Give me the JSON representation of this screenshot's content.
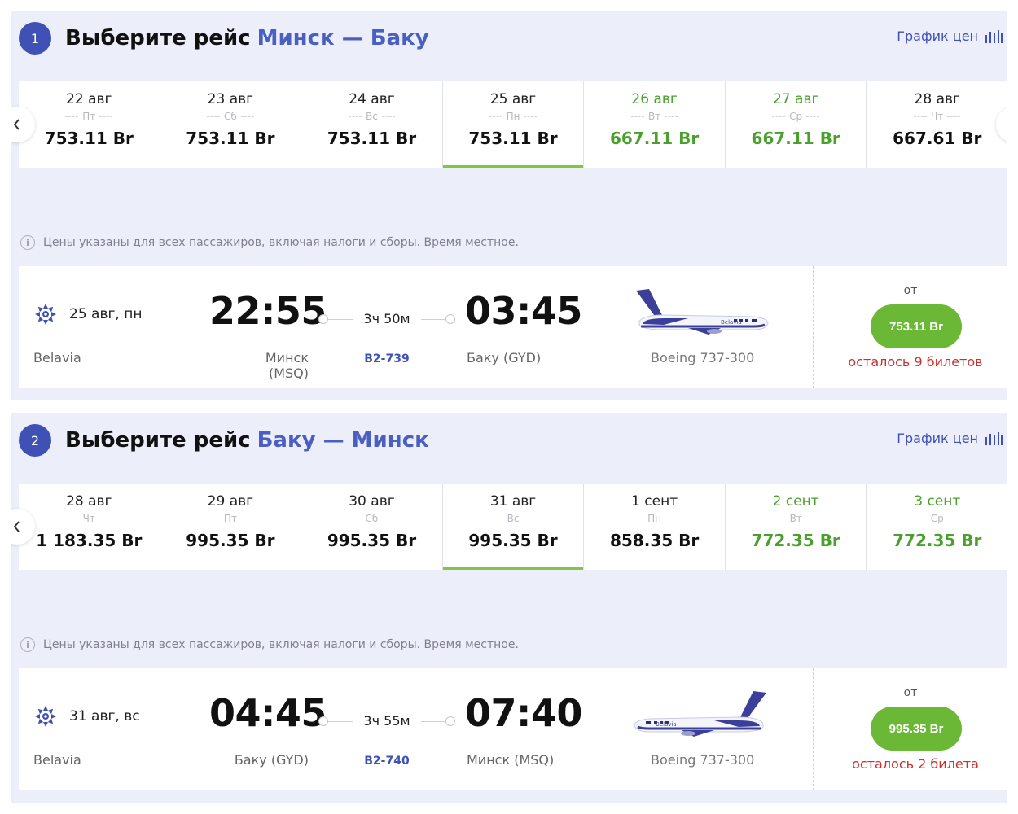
{
  "outbound": {
    "step": "1",
    "title": "Выберите рейс",
    "route": "Минск — Баку",
    "chart_link": "График цен",
    "dates": [
      {
        "date": "22 авг",
        "weekday": "Пт",
        "price": "753.11 Br",
        "state": "normal"
      },
      {
        "date": "23 авг",
        "weekday": "Сб",
        "price": "753.11 Br",
        "state": "normal"
      },
      {
        "date": "24 авг",
        "weekday": "Вс",
        "price": "753.11 Br",
        "state": "normal"
      },
      {
        "date": "25 авг",
        "weekday": "Пн",
        "price": "753.11 Br",
        "state": "active"
      },
      {
        "date": "26 авг",
        "weekday": "Вт",
        "price": "667.11 Br",
        "state": "green"
      },
      {
        "date": "27 авг",
        "weekday": "Ср",
        "price": "667.11 Br",
        "state": "green"
      },
      {
        "date": "28 авг",
        "weekday": "Чт",
        "price": "667.61 Br",
        "state": "normal"
      }
    ],
    "info": "Цены указаны для всех пассажиров, включая налоги и сборы. Время местное.",
    "flight": {
      "date": "25 авг, пн",
      "airline": "Belavia",
      "dep_time": "22:55",
      "dep_airport": "Минск (MSQ)",
      "duration": "3ч 50м",
      "flight_no": "B2-739",
      "arr_time": "03:45",
      "arr_airport": "Баку (GYD)",
      "aircraft": "Boeing 737-300",
      "plane_logo_text": "Belavia",
      "from_label": "от",
      "price": "753.11 Br",
      "seats_left": "осталось 9 билетов"
    }
  },
  "inbound": {
    "step": "2",
    "title": "Выберите рейс",
    "route": "Баку — Минск",
    "chart_link": "График цен",
    "dates": [
      {
        "date": "28 авг",
        "weekday": "Чт",
        "price": "1 183.35 Br",
        "state": "normal"
      },
      {
        "date": "29 авг",
        "weekday": "Пт",
        "price": "995.35 Br",
        "state": "normal"
      },
      {
        "date": "30 авг",
        "weekday": "Сб",
        "price": "995.35 Br",
        "state": "normal"
      },
      {
        "date": "31 авг",
        "weekday": "Вс",
        "price": "995.35 Br",
        "state": "active"
      },
      {
        "date": "1 сент",
        "weekday": "Пн",
        "price": "858.35 Br",
        "state": "normal"
      },
      {
        "date": "2 сент",
        "weekday": "Вт",
        "price": "772.35 Br",
        "state": "green"
      },
      {
        "date": "3 сент",
        "weekday": "Ср",
        "price": "772.35 Br",
        "state": "green"
      }
    ],
    "info": "Цены указаны для всех пассажиров, включая налоги и сборы. Время местное.",
    "flight": {
      "date": "31 авг, вс",
      "airline": "Belavia",
      "dep_time": "04:45",
      "dep_airport": "Баку (GYD)",
      "duration": "3ч 55м",
      "flight_no": "B2-740",
      "arr_time": "07:40",
      "arr_airport": "Минск (MSQ)",
      "aircraft": "Boeing 737-300",
      "plane_logo_text": "Belavia",
      "from_label": "от",
      "price": "995.35 Br",
      "seats_left": "осталось 2 билета"
    }
  },
  "icons": {
    "nav_prev": "chevron-left-icon",
    "nav_next": "chevron-right-icon",
    "info": "info-icon",
    "chart": "bar-chart-icon",
    "airline": "belavia-logo-icon",
    "aircraft": "airplane-icon"
  },
  "colors": {
    "accent": "#3f51b5",
    "section_bg": "#eceefa",
    "green_price": "#4aa02c",
    "active_underline": "#7ac943",
    "price_button": "#6ab835",
    "seats_left": "#c8322d"
  }
}
